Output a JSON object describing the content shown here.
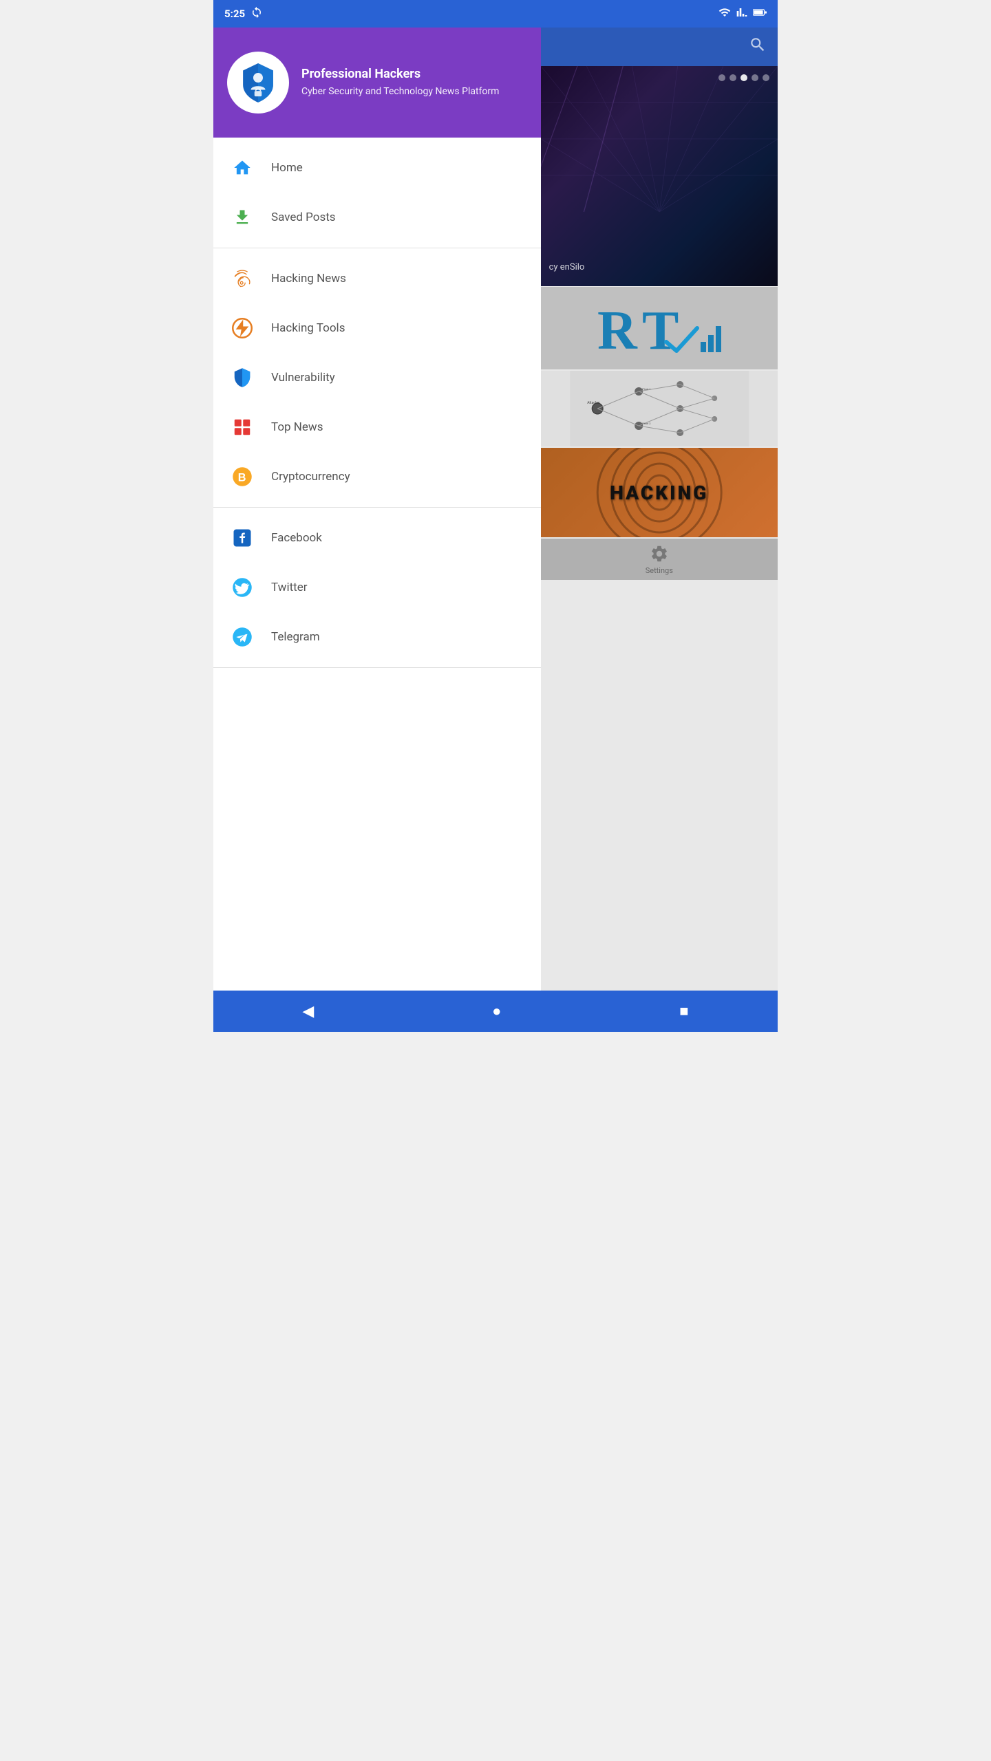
{
  "statusBar": {
    "time": "5:25",
    "syncIcon": "sync-icon"
  },
  "drawer": {
    "appName": "Professional Hackers",
    "appSubtitle": "Cyber Security and Technology News Platform",
    "sections": [
      {
        "items": [
          {
            "id": "home",
            "label": "Home",
            "icon": "home-icon",
            "iconType": "home"
          },
          {
            "id": "saved-posts",
            "label": "Saved Posts",
            "icon": "save-icon",
            "iconType": "save"
          }
        ]
      },
      {
        "items": [
          {
            "id": "hacking-news",
            "label": "Hacking News",
            "icon": "fingerprint-icon",
            "iconType": "fingerprint"
          },
          {
            "id": "hacking-tools",
            "label": "Hacking Tools",
            "icon": "bolt-icon",
            "iconType": "bolt"
          },
          {
            "id": "vulnerability",
            "label": "Vulnerability",
            "icon": "shield-icon",
            "iconType": "shield"
          },
          {
            "id": "top-news",
            "label": "Top News",
            "icon": "grid-icon",
            "iconType": "grid"
          },
          {
            "id": "cryptocurrency",
            "label": "Cryptocurrency",
            "icon": "bitcoin-icon",
            "iconType": "bitcoin"
          }
        ]
      },
      {
        "items": [
          {
            "id": "facebook",
            "label": "Facebook",
            "icon": "facebook-icon",
            "iconType": "facebook"
          },
          {
            "id": "twitter",
            "label": "Twitter",
            "icon": "twitter-icon",
            "iconType": "twitter"
          },
          {
            "id": "telegram",
            "label": "Telegram",
            "icon": "telegram-icon",
            "iconType": "telegram"
          }
        ]
      }
    ]
  },
  "content": {
    "bannerText": "cy enSilo",
    "dots": [
      false,
      false,
      true,
      false,
      false
    ],
    "cards": {
      "rtLogo": "RT",
      "hackingLabel": "HACKING",
      "settings": "Settings"
    }
  },
  "bottomNav": {
    "back": "◀",
    "home": "●",
    "recent": "■"
  }
}
